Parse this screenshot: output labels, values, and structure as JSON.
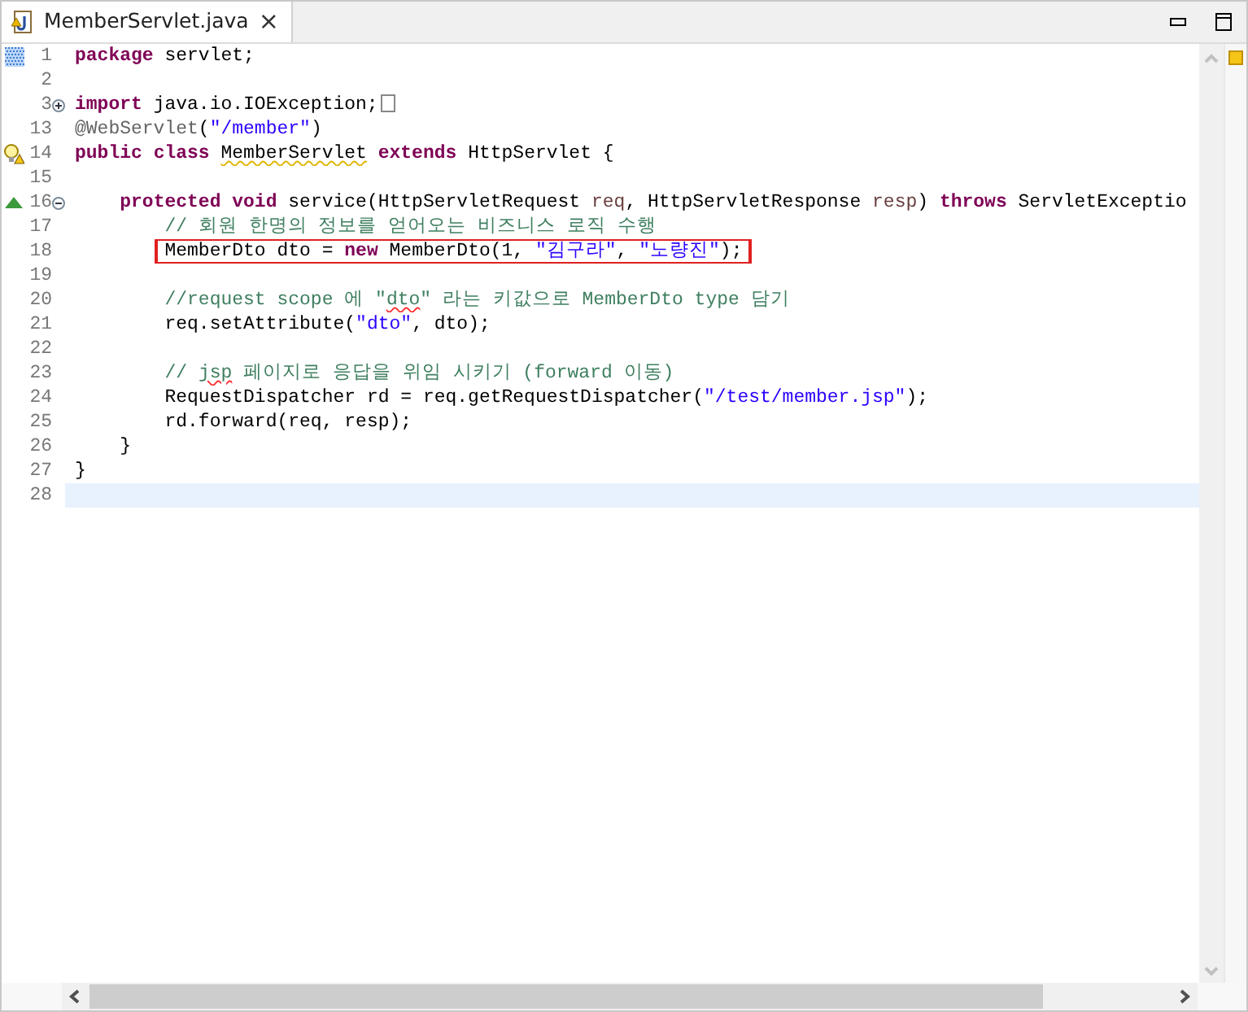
{
  "tab": {
    "label": "MemberServlet.java",
    "close": "×",
    "selected": true
  },
  "lines": [
    {
      "number": "1",
      "bookmark": true,
      "tokens": [
        {
          "kind": "keyword",
          "text": "package "
        },
        {
          "kind": "plain",
          "text": "servlet;"
        }
      ]
    },
    {
      "number": "2"
    },
    {
      "number": "3",
      "expanded": false,
      "folded_marker": true,
      "tokens": [
        {
          "kind": "keyword",
          "text": "import "
        },
        {
          "kind": "plain",
          "text": "java.io.IOException;"
        }
      ]
    },
    {
      "number": "13",
      "tokens": [
        {
          "kind": "annotation",
          "text": "@WebServlet"
        },
        {
          "kind": "plain",
          "text": "("
        },
        {
          "kind": "string",
          "text": "\"/member\""
        },
        {
          "kind": "plain",
          "text": ")"
        }
      ]
    },
    {
      "number": "14",
      "warning": true,
      "tokens": [
        {
          "kind": "keyword",
          "text": "public "
        },
        {
          "kind": "keyword",
          "text": "class "
        },
        {
          "kind": "plain",
          "text": "MemberServlet",
          "warning": true
        },
        {
          "kind": "keyword",
          "text": " extends"
        },
        {
          "kind": "plain",
          "text": " HttpServlet {"
        }
      ]
    },
    {
      "number": "15"
    },
    {
      "number": "16",
      "override": true,
      "expanded": true,
      "tokens": [
        {
          "kind": "keyword",
          "text": "    protected "
        },
        {
          "kind": "keyword",
          "text": "void"
        },
        {
          "kind": "plain",
          "text": " service(HttpServletRequest "
        },
        {
          "kind": "param",
          "text": "req"
        },
        {
          "kind": "plain",
          "text": ", HttpServletResponse "
        },
        {
          "kind": "param",
          "text": "resp"
        },
        {
          "kind": "plain",
          "text": ") "
        },
        {
          "kind": "keyword",
          "text": "throws"
        },
        {
          "kind": "plain",
          "text": " ServletExceptio"
        }
      ]
    },
    {
      "number": "17",
      "tokens": [
        {
          "kind": "comment",
          "text": "        // 회원 한명의 정보를 얻어오는 비즈니스 로직 수행"
        }
      ]
    },
    {
      "number": "18",
      "boxed": true,
      "tokens": [
        {
          "kind": "plain",
          "text": "        MemberDto dto = "
        },
        {
          "kind": "keyword",
          "text": "new"
        },
        {
          "kind": "plain",
          "text": " MemberDto(1, "
        },
        {
          "kind": "string",
          "text": "\"김구라\""
        },
        {
          "kind": "plain",
          "text": ", "
        },
        {
          "kind": "string",
          "text": "\"노량진\""
        },
        {
          "kind": "plain",
          "text": ");"
        }
      ]
    },
    {
      "number": "19"
    },
    {
      "number": "20",
      "tokens": [
        {
          "kind": "comment",
          "text": "        //request scope 에 \""
        },
        {
          "kind": "comment",
          "text": "dto",
          "misspelled": true
        },
        {
          "kind": "comment",
          "text": "\" 라는 키값으로 MemberDto type 담기"
        }
      ]
    },
    {
      "number": "21",
      "tokens": [
        {
          "kind": "plain",
          "text": "        req.setAttribute("
        },
        {
          "kind": "string",
          "text": "\"dto\""
        },
        {
          "kind": "plain",
          "text": ", dto);"
        }
      ]
    },
    {
      "number": "22"
    },
    {
      "number": "23",
      "tokens": [
        {
          "kind": "comment",
          "text": "        // "
        },
        {
          "kind": "comment",
          "text": "jsp",
          "misspelled": true
        },
        {
          "kind": "comment",
          "text": " 페이지로 응답을 위임 시키기 (forward 이동)"
        }
      ]
    },
    {
      "number": "24",
      "tokens": [
        {
          "kind": "plain",
          "text": "        RequestDispatcher rd = req.getRequestDispatcher("
        },
        {
          "kind": "string",
          "text": "\"/test/member.jsp\""
        },
        {
          "kind": "plain",
          "text": ");"
        }
      ]
    },
    {
      "number": "25",
      "tokens": [
        {
          "kind": "plain",
          "text": "        rd.forward(req, resp);"
        }
      ]
    },
    {
      "number": "26",
      "tokens": [
        {
          "kind": "plain",
          "text": "    }"
        }
      ]
    },
    {
      "number": "27",
      "tokens": [
        {
          "kind": "plain",
          "text": "}"
        }
      ]
    },
    {
      "number": "28",
      "current": true
    }
  ]
}
